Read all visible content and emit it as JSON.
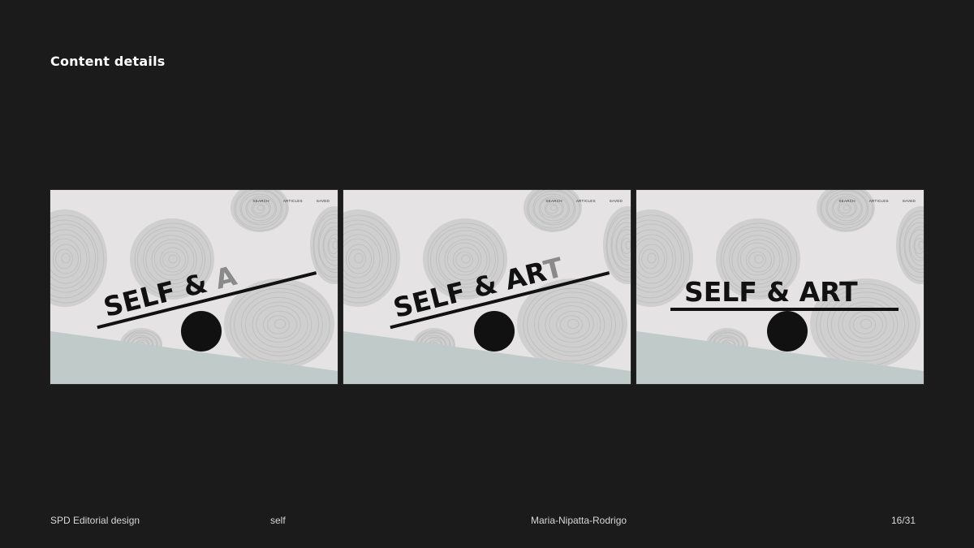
{
  "slide": {
    "title": "Content details"
  },
  "mockup": {
    "nav": [
      "SEARCH",
      "ARTICLES",
      "SAVED"
    ],
    "frames": [
      {
        "dark_text": "SELF & ",
        "faded_text": "A"
      },
      {
        "dark_text": "SELF & AR",
        "faded_text": "T"
      },
      {
        "dark_text": "SELF & ART",
        "faded_text": ""
      }
    ]
  },
  "footer": {
    "course": "SPD Editorial design",
    "project": "self",
    "author": "Maria-Nipatta-Rodrigo",
    "page": "16/31"
  },
  "colors": {
    "background": "#1b1b1b",
    "panel": "#e5e3e3",
    "blob": "#cfcfcf",
    "ground": "#bfcac9",
    "ink": "#111111",
    "faded_letter": "#8a8a8a"
  }
}
